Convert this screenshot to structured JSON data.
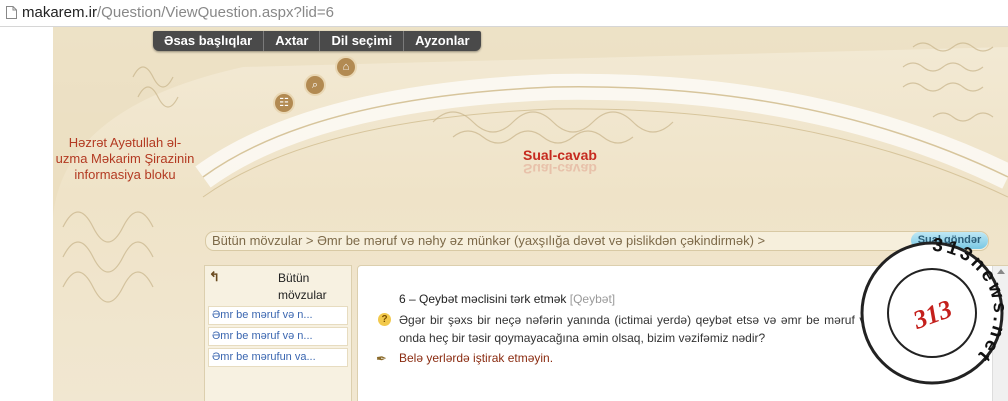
{
  "address_bar": {
    "domain": "makarem.ir",
    "path": "/Question/ViewQuestion.aspx?lid=6"
  },
  "nav": {
    "items": [
      {
        "label": "Əsas başlıqlar"
      },
      {
        "label": "Axtar"
      },
      {
        "label": "Dil seçimi"
      },
      {
        "label": "Ayzonlar"
      }
    ]
  },
  "header": {
    "blurb": "Həzrət Ayətullah əl-uzma Məkarim Şirazinin informasiya bloku",
    "site_title": "Sual-cavab"
  },
  "breadcrumb": {
    "text": "Bütün mövzular > Əmr be məruf və nəhy əz münkər (yaxşılığa dəvət və pislikdən çəkindirmək) >",
    "ask_button": "Sual göndər"
  },
  "side_panel": {
    "all_label": "Bütün mövzular",
    "items": [
      {
        "label": "Əmr be məruf və n..."
      },
      {
        "label": "Əmr be məruf və n..."
      },
      {
        "label": "Əmr be mərufun va..."
      }
    ]
  },
  "question": {
    "title": "6 – Qeybət məclisini tərk etmək",
    "tag": "[Qeybət]",
    "text": "Əgər bir şəxs bir neçə nəfərin yanında (ictimai yerdə) qeybət etsə və əmr be məruf və nəhy əz münkərin onda heç bir təsir qoymayacağına əmin olsaq, bizim vəzifəmiz nədir?",
    "answer": "Belə yerlərdə iştirak etməyin."
  },
  "watermark": {
    "ring_text": "313news.net",
    "center": "313"
  },
  "colors": {
    "page_bg": "#efe3c8",
    "nav_bg": "#4a4a4a",
    "title_red": "#c62a1f",
    "link_blue": "#3a66b0",
    "answer_color": "#8a2b10"
  }
}
